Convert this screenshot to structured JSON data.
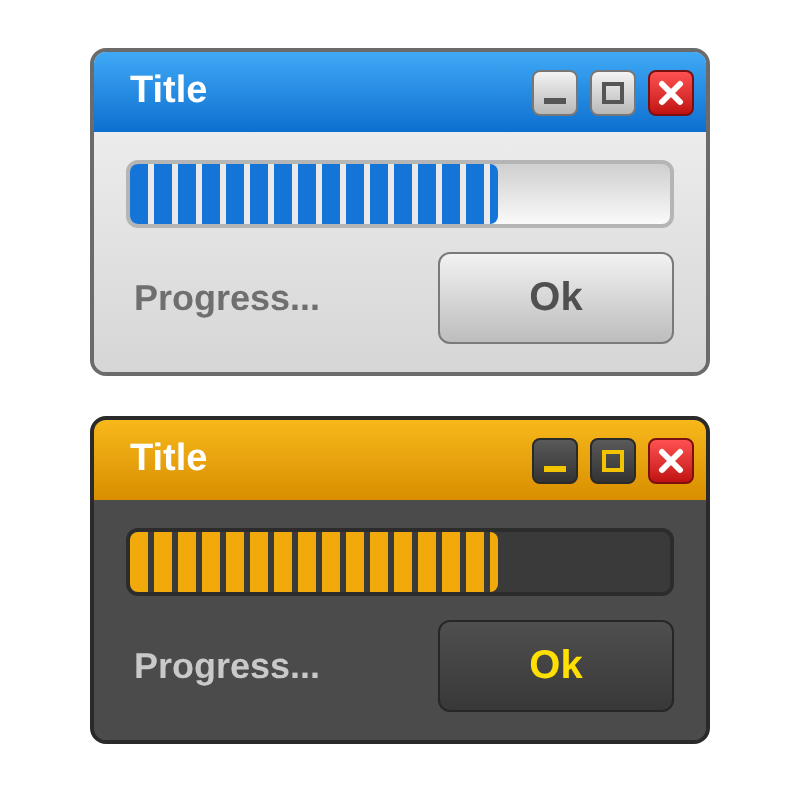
{
  "windows": [
    {
      "kind": "light",
      "title": "Title",
      "progress": {
        "level": 0.68
      },
      "status": "Progress...",
      "button": "Ok"
    },
    {
      "kind": "dark",
      "title": "Title",
      "progress": {
        "level": 0.68
      },
      "status": "Progress...",
      "button": "Ok"
    }
  ]
}
